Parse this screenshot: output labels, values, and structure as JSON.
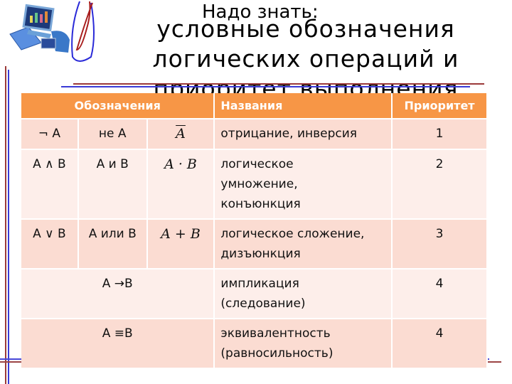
{
  "header": {
    "subtitle": "Надо знать:",
    "title_lines": [
      "условные обозначения",
      "логических операций и",
      "приоритет выполнения"
    ]
  },
  "decor": {
    "logo_icon": "computer-clipart-icon",
    "colors": {
      "red_line": "#9b3a3a",
      "blue_line": "#3a3ad6",
      "header_bg": "#f79646",
      "row_odd": "#fbdcd2",
      "row_even": "#fdeeea"
    }
  },
  "table": {
    "headers": [
      "Обозначения",
      "Названия",
      "Приоритет"
    ],
    "rows": [
      {
        "symbol": "¬ A",
        "words": "не А",
        "formula": "A",
        "name": "отрицание, инверсия",
        "priority": "1"
      },
      {
        "symbol": "А ∧ В",
        "words": "А и В",
        "formula": "A · B",
        "name_lines": [
          "логическое",
          "умножение,",
          "конъюнкция"
        ],
        "priority": "2"
      },
      {
        "symbol": "А ∨ В",
        "words": "А или В",
        "formula": "A + B",
        "name_lines": [
          "логическое сложение,",
          "дизъюнкция"
        ],
        "priority": "3"
      },
      {
        "symbol": "А →В",
        "name_lines": [
          "импликация",
          "(следование)"
        ],
        "priority": "4"
      },
      {
        "symbol": "А ≡В",
        "name_lines": [
          "эквивалентность",
          "(равносильность)"
        ],
        "priority": "4"
      }
    ]
  }
}
